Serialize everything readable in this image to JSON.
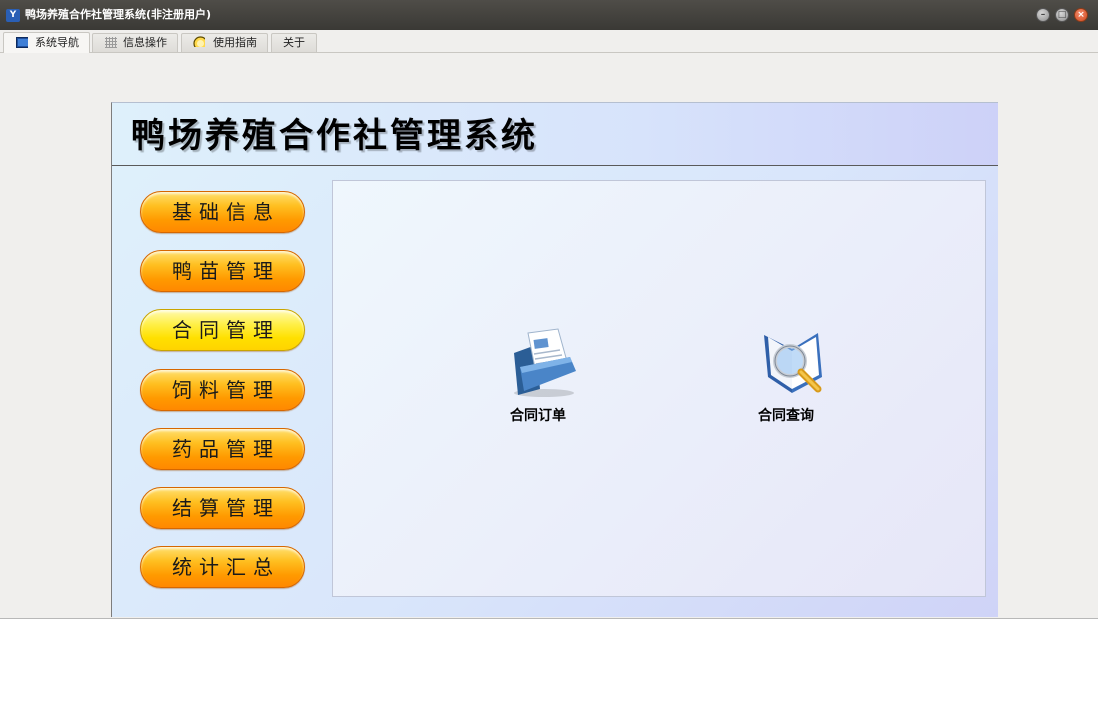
{
  "window": {
    "title": "鸭场养殖合作社管理系统(非注册用户)",
    "app_icon_text": "Y",
    "controls": {
      "minimize": "–",
      "maximize": "□",
      "close": "×"
    }
  },
  "tabs": [
    {
      "label": "系统导航",
      "icon": "monitor-icon",
      "active": true
    },
    {
      "label": "信息操作",
      "icon": "grid-icon",
      "active": false
    },
    {
      "label": "使用指南",
      "icon": "help-icon",
      "active": false
    },
    {
      "label": "关于",
      "icon": "",
      "active": false
    }
  ],
  "header": {
    "title": "鸭场养殖合作社管理系统"
  },
  "nav": [
    {
      "label": "基础信息"
    },
    {
      "label": "鸭苗管理"
    },
    {
      "label": "合同管理",
      "active": true
    },
    {
      "label": "饲料管理"
    },
    {
      "label": "药品管理"
    },
    {
      "label": "结算管理"
    },
    {
      "label": "统计汇总"
    }
  ],
  "features": [
    {
      "label": "合同订单",
      "icon": "document-folder-icon"
    },
    {
      "label": "合同查询",
      "icon": "magnifier-book-icon"
    }
  ],
  "colors": {
    "nav_button": "#ff9a00",
    "nav_button_active": "#ffe000",
    "titlebar": "#3f3e3a"
  }
}
